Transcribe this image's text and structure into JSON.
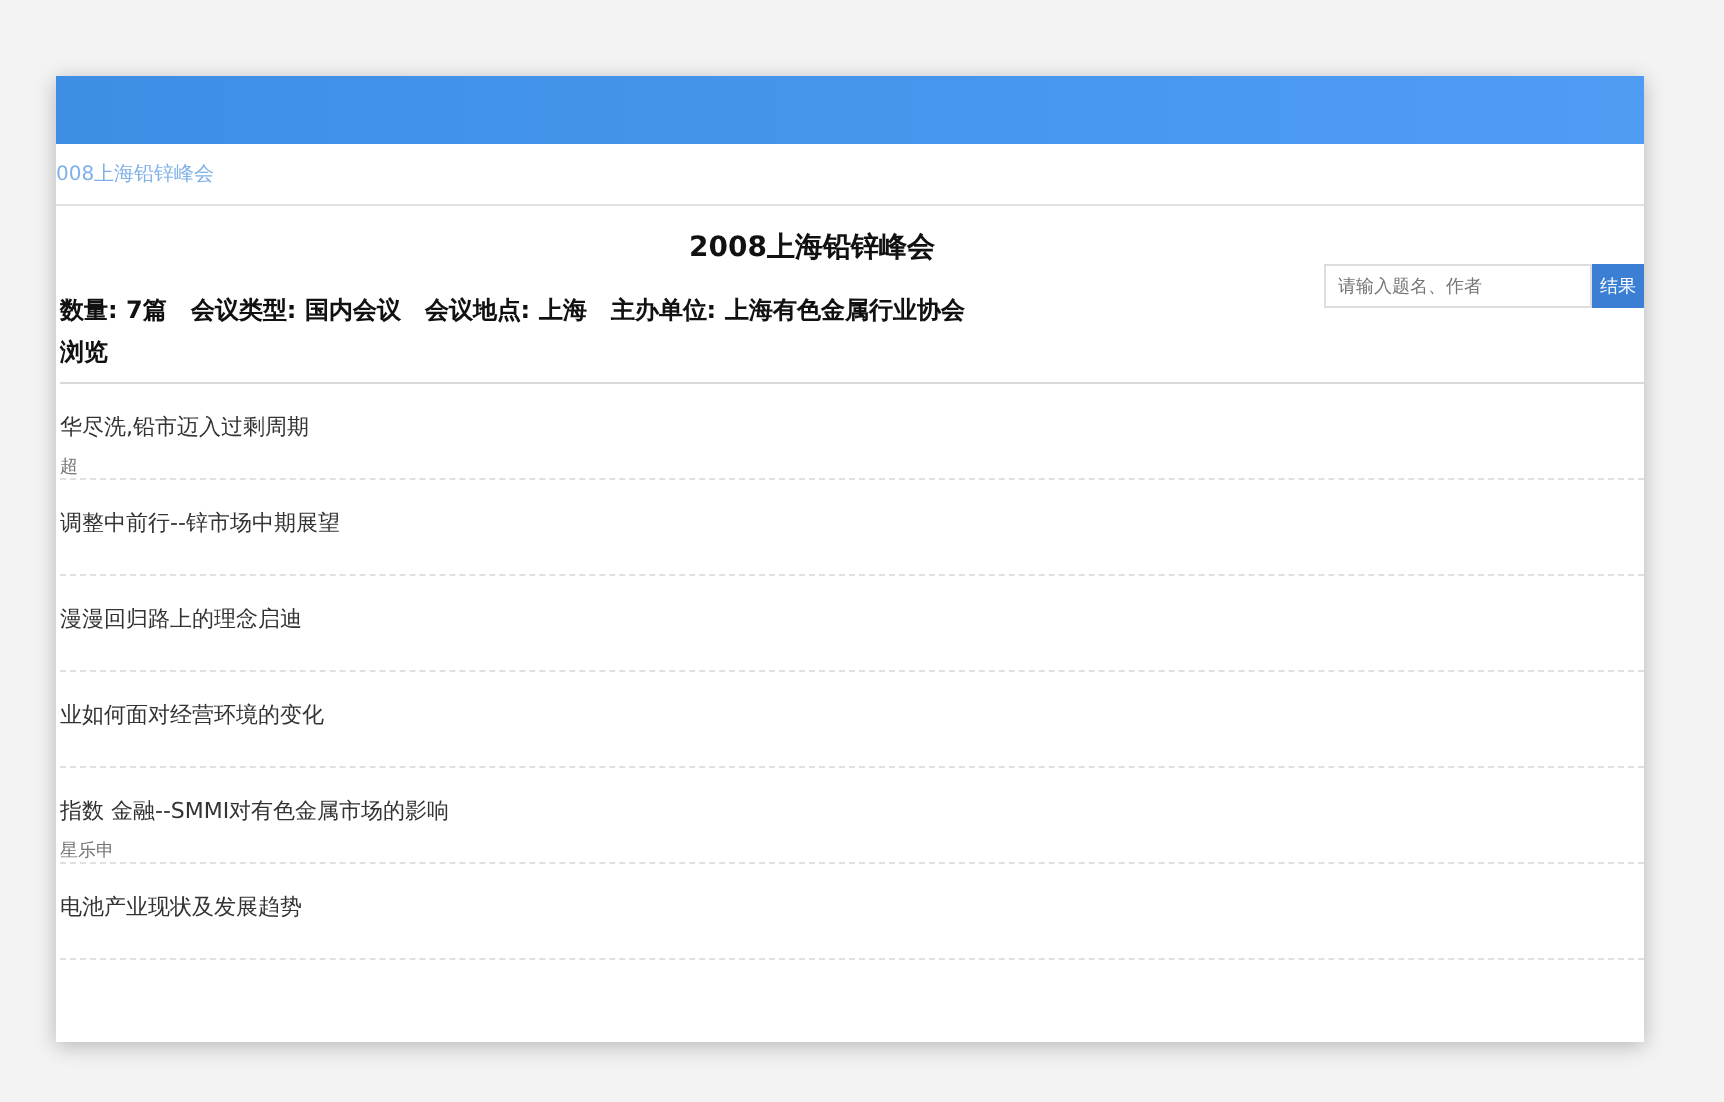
{
  "breadcrumb": "008上海铅锌峰会",
  "title": "2008上海铅锌峰会",
  "meta": "数量: 7篇　会议类型: 国内会议　会议地点: 上海　主办单位: 上海有色金属行业协会",
  "search": {
    "placeholder": "请输入题名、作者",
    "button": "结果"
  },
  "section": "浏览",
  "articles": [
    {
      "title": "华尽洗,铅市迈入过剩周期",
      "author": "超"
    },
    {
      "title": "调整中前行--锌市场中期展望"
    },
    {
      "title": "漫漫回归路上的理念启迪"
    },
    {
      "title": "业如何面对经营环境的变化"
    },
    {
      "title": "指数 金融--SMMI对有色金属市场的影响",
      "author": "星乐申"
    },
    {
      "title": "电池产业现状及发展趋势"
    }
  ]
}
